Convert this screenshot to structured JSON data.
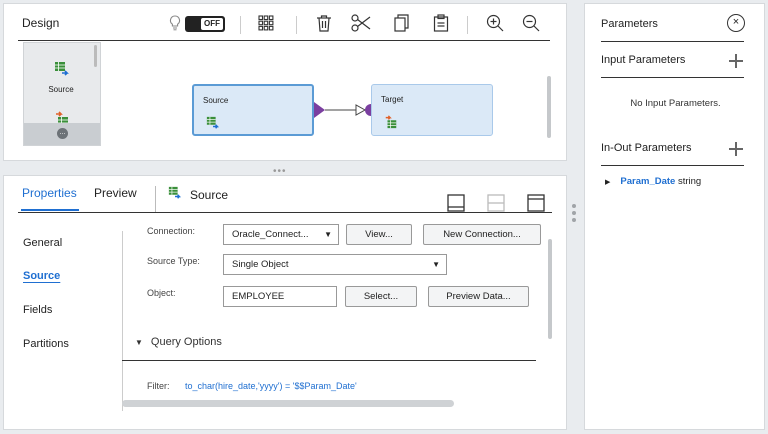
{
  "design": {
    "title": "Design",
    "toggle_label": "OFF",
    "palette_item_label": "Source",
    "palette_more": "...",
    "nodes": {
      "source_label": "Source",
      "target_label": "Target"
    }
  },
  "properties": {
    "tabs": {
      "properties": "Properties",
      "preview": "Preview",
      "object": "Source"
    },
    "nav": {
      "general": "General",
      "source": "Source",
      "fields": "Fields",
      "partitions": "Partitions"
    },
    "form": {
      "connection_label": "Connection:",
      "connection_value": "Oracle_Connect...",
      "view_button": "View...",
      "new_connection_button": "New Connection...",
      "source_type_label": "Source Type:",
      "source_type_value": "Single Object",
      "object_label": "Object:",
      "object_value": "EMPLOYEE",
      "select_button": "Select...",
      "preview_data_button": "Preview Data...",
      "query_options": "Query Options",
      "filter_label": "Filter:",
      "filter_value": "to_char(hire_date,'yyyy') = '$$Param_Date'"
    }
  },
  "parameters": {
    "title": "Parameters",
    "close": "×",
    "input_section": "Input Parameters",
    "no_input": "No Input Parameters.",
    "inout_section": "In-Out Parameters",
    "items": [
      {
        "name": "Param_Date",
        "type": "string"
      }
    ]
  },
  "colors": {
    "accent": "#1f6fd1",
    "node_fill": "#dbe9f7",
    "node_border": "#5b9bd5",
    "link_purple": "#7b3fa0"
  }
}
